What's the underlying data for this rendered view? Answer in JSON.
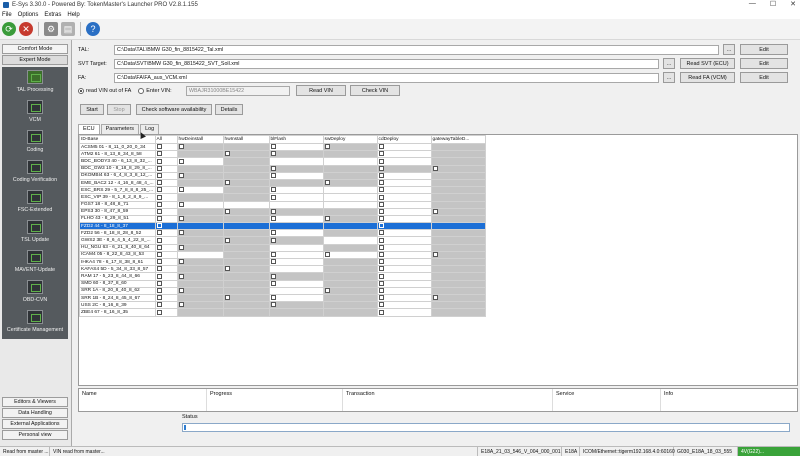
{
  "window": {
    "title": "E-Sys 3.30.0 - Powered By: TokenMaster's Launcher PRO V2.8.1.155",
    "min": "—",
    "max": "☐",
    "close": "✕"
  },
  "menu": [
    "File",
    "Options",
    "Extras",
    "Help"
  ],
  "sidebar": {
    "modes": [
      "Comfort Mode",
      "Expert Mode"
    ],
    "items": [
      "TAL Processing",
      "VCM",
      "Coding",
      "Coding Verification",
      "FSC-Extended",
      "TSL Update",
      "MAVENT-Update",
      "OBD-CVN",
      "Certificate Management"
    ],
    "bottom": [
      "Editors & Viewers",
      "Data Handling",
      "External Applications",
      "Personal view"
    ]
  },
  "form": {
    "tal_label": "TAL:",
    "tal_value": "C:\\Data\\TAL\\BMW G30_fin_8815422_Tal.xml",
    "svt_label": "SVT Target:",
    "svt_value": "C:\\Data\\SVT\\BMW G30_fin_8815422_SVT_Soll.xml",
    "fa_label": "FA:",
    "fa_value": "C:\\Data\\FA\\FA_aus_VCM.xml",
    "radio_vin_fa": "read VIN out of FA",
    "radio_enter_vin": "Enter VIN:",
    "vin_value": "WBAJR31000BE15422",
    "browse": "...",
    "edit": "Edit",
    "read_svt": "Read SVT (ECU)",
    "read_fa": "Read FA (VCM)",
    "read_vin": "Read VIN",
    "check_vin": "Check VIN"
  },
  "actions": {
    "start": "Start",
    "stop": "Stop",
    "check": "Check software availability",
    "details": "Details"
  },
  "tabs": [
    "ECU",
    "Parameters",
    "Log"
  ],
  "grid": {
    "headers": [
      "ID-Base",
      "All",
      "hwDeinstall",
      "hwInstall",
      "blFlash",
      "swDeploy",
      "cdDeploy",
      "gatewayTableD..."
    ],
    "rows": [
      "ACSM5 01 - 8_11_0_20_0_34",
      "ATM2 61 - 8_13_8_34_8_58",
      "BDC_BODY3 40 - 6_13_8_32_...",
      "BDC_GW3 10 - 8_18_8_29_8_...",
      "DKOMBI4 63 - 6_4_8_3_8_12_...",
      "EME_BAC2 12 - 4_16_8_48_4_...",
      "ESC_BRS 29 - 5_7_8_8_8_25_...",
      "ESC_VIP 39 - 8_1_8_2_8_9_...",
      "FGS7 18 - 8_48_8_71",
      "EPS3 30 - 8_47_8_59",
      "FLHO 43 - 8_29_8_51",
      "FZD2 44 - 8_18_8_37",
      "FZD2 56 - 8_18_8_28_8_52",
      "GWS2 3E - 8_6_4_5_4_22_8_...",
      "HU_NGU 63 - 6_21_8_40_8_64",
      "ICAM4 05 - 8_22_8_43_8_53",
      "IHKA4 78 - 6_17_8_38_8_61",
      "KAFAS4 5D - 5_34_8_33_8_57",
      "RAM 17 - 5_23_8_44_8_66",
      "SMD 60 - 8_37_8_60",
      "SRR 1A - 8_20_8_40_8_62",
      "SRR 1B - 8_24_8_45_8_67",
      "USS 2C - 8_16_8_39",
      "ZBE4 67 - 8_16_8_35"
    ]
  },
  "bottom_table": {
    "headers": [
      "Name",
      "Progress",
      "Transaction",
      "Service",
      "Info"
    ]
  },
  "status": {
    "label": "Status"
  },
  "statusbar": {
    "left": "Read from master ...",
    "vin": "VIN read from master...",
    "seg1": "E18A_21_03_546_V_004_000_001",
    "seg2": "E18A",
    "seg3": "ICOM/Ethernet::tigerm192.168.4.0:60160",
    "seg4": "G030_E18A_18_03_555",
    "seg5": "4V(G22)..."
  }
}
